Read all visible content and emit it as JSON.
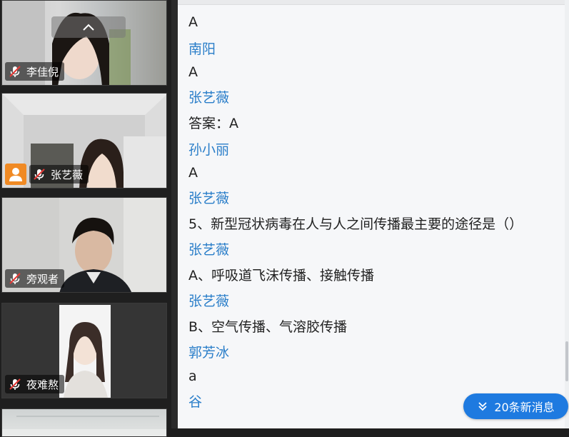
{
  "participants": [
    {
      "name": "李佳倪",
      "muted": true,
      "host": false
    },
    {
      "name": "张艺薇",
      "muted": true,
      "host": true
    },
    {
      "name": "旁观者",
      "muted": true,
      "host": false
    },
    {
      "name": "夜难熬",
      "muted": true,
      "host": false
    }
  ],
  "chat": {
    "messages": [
      {
        "kind": "text",
        "text": "A"
      },
      {
        "kind": "sender",
        "text": "南阳"
      },
      {
        "kind": "text",
        "text": "A"
      },
      {
        "kind": "sender",
        "text": "张艺薇"
      },
      {
        "kind": "text",
        "text": "答案：A"
      },
      {
        "kind": "sender",
        "text": "孙小丽"
      },
      {
        "kind": "text",
        "text": "A"
      },
      {
        "kind": "sender",
        "text": "张艺薇"
      },
      {
        "kind": "text",
        "text": "5、新型冠状病毒在人与人之间传播最主要的途径是（）"
      },
      {
        "kind": "sender",
        "text": "张艺薇"
      },
      {
        "kind": "text",
        "text": "A、呼吸道飞沫传播、接触传播"
      },
      {
        "kind": "sender",
        "text": "张艺薇"
      },
      {
        "kind": "text",
        "text": "B、空气传播、气溶胶传播"
      },
      {
        "kind": "sender",
        "text": "郭芳冰"
      },
      {
        "kind": "text",
        "text": "a"
      },
      {
        "kind": "sender",
        "text": "谷"
      }
    ],
    "new_messages_label": "20条新消息"
  },
  "colors": {
    "sender": "#2a7ec9",
    "accent": "#1e7ae0",
    "host_badge": "#f08a24"
  },
  "icons": {
    "mic_off": "mic-off-icon",
    "host": "person-icon",
    "collapse": "chevron-up-icon",
    "new_messages": "double-chevron-down-icon"
  }
}
